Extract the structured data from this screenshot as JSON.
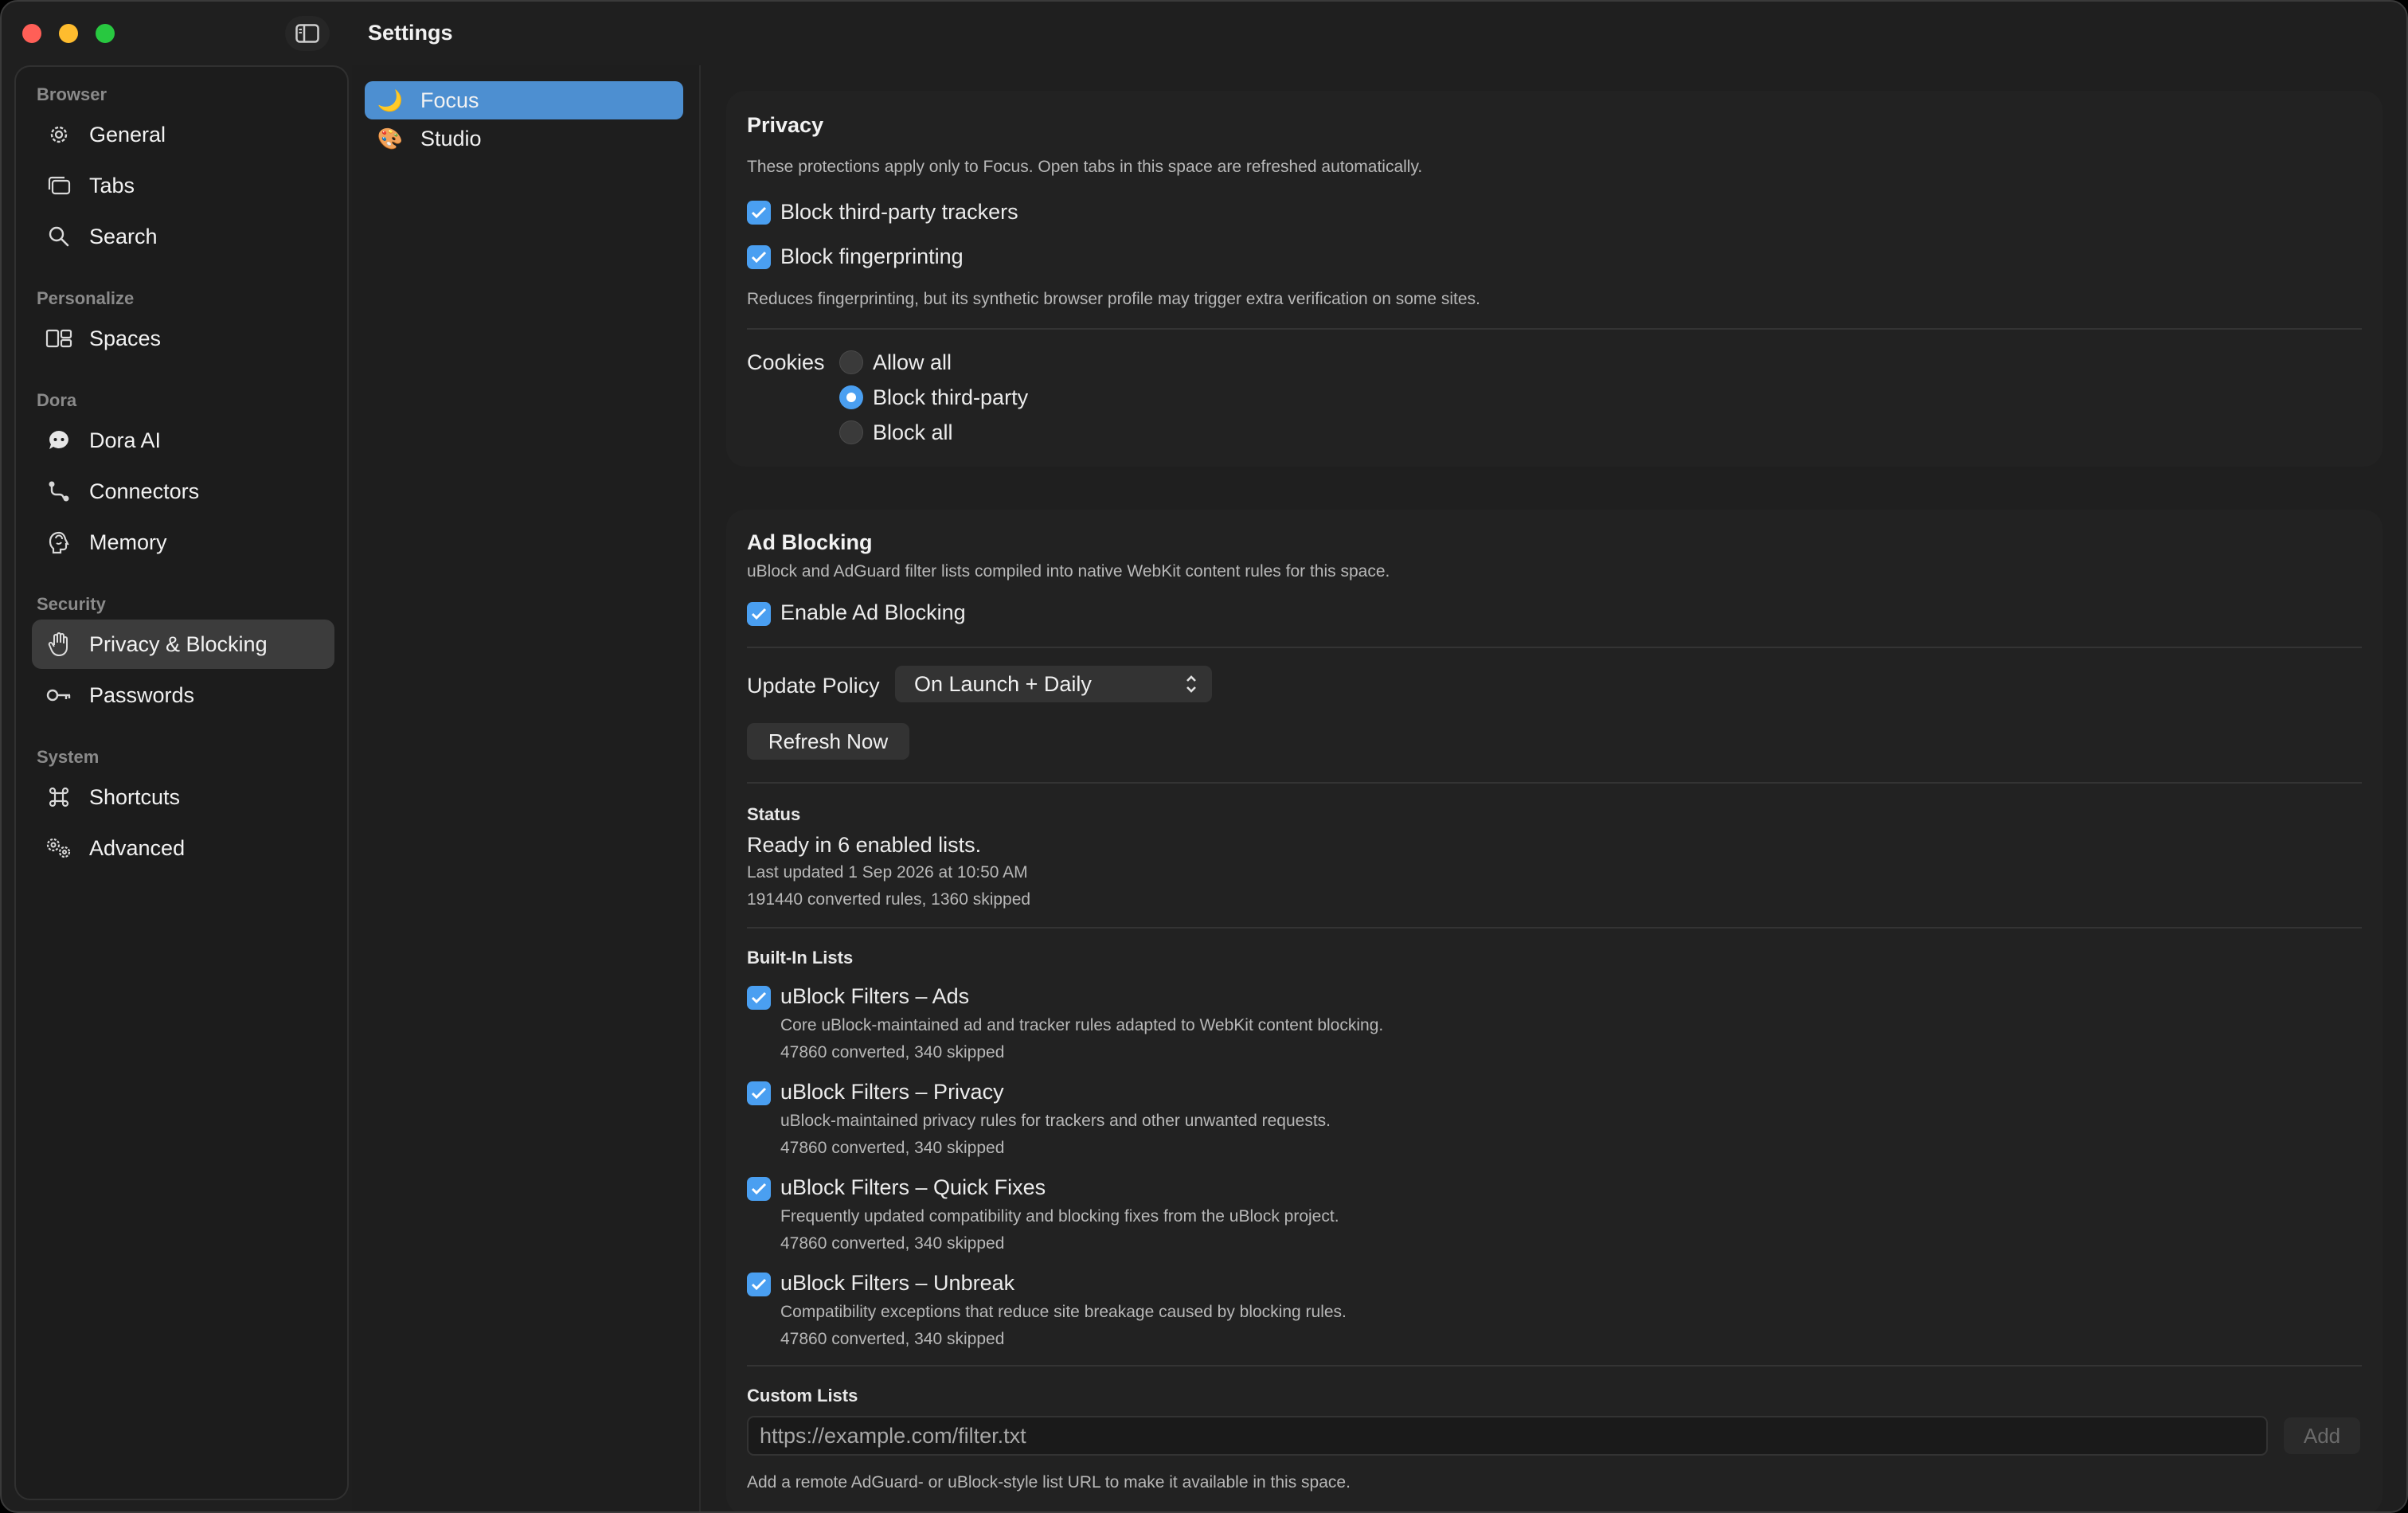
{
  "window": {
    "title": "Settings"
  },
  "sidebar": {
    "sections": [
      {
        "title": "Browser",
        "items": [
          {
            "label": "General",
            "icon": "gear-icon"
          },
          {
            "label": "Tabs",
            "icon": "tabs-icon"
          },
          {
            "label": "Search",
            "icon": "search-icon"
          }
        ]
      },
      {
        "title": "Personalize",
        "items": [
          {
            "label": "Spaces",
            "icon": "spaces-icon"
          }
        ]
      },
      {
        "title": "Dora",
        "items": [
          {
            "label": "Dora AI",
            "icon": "chat-bubble-icon"
          },
          {
            "label": "Connectors",
            "icon": "connector-icon"
          },
          {
            "label": "Memory",
            "icon": "brain-icon"
          }
        ]
      },
      {
        "title": "Security",
        "items": [
          {
            "label": "Privacy & Blocking",
            "icon": "hand-icon",
            "selected": true
          },
          {
            "label": "Passwords",
            "icon": "key-icon"
          }
        ]
      },
      {
        "title": "System",
        "items": [
          {
            "label": "Shortcuts",
            "icon": "command-icon"
          },
          {
            "label": "Advanced",
            "icon": "gears-icon"
          }
        ]
      }
    ]
  },
  "spaces": [
    {
      "label": "Focus",
      "icon": "🌙",
      "selected": true
    },
    {
      "label": "Studio",
      "icon": "🎨"
    }
  ],
  "privacy": {
    "title": "Privacy",
    "description": "These protections apply only to Focus. Open tabs in this space are refreshed automatically.",
    "block_trackers": "Block third-party trackers",
    "block_fingerprinting": "Block fingerprinting",
    "fingerprint_note": "Reduces fingerprinting, but its synthetic browser profile may trigger extra verification on some sites.",
    "cookies_label": "Cookies",
    "cookie_options": [
      "Allow all",
      "Block third-party",
      "Block all"
    ],
    "cookie_selected": "Block third-party"
  },
  "adblock": {
    "title": "Ad Blocking",
    "description": "uBlock and AdGuard filter lists compiled into native WebKit content rules for this space.",
    "enable_label": "Enable Ad Blocking",
    "update_policy_label": "Update Policy",
    "update_policy_value": "On Launch + Daily",
    "refresh_label": "Refresh Now",
    "status": {
      "heading": "Status",
      "line1": "Ready in 6 enabled lists.",
      "line2": "Last updated 1 Sep 2026 at 10:50 AM",
      "line3": "191440 converted rules, 1360 skipped"
    },
    "builtin_heading": "Built-In Lists",
    "lists": [
      {
        "name": "uBlock Filters – Ads",
        "desc": "Core uBlock-maintained ad and tracker rules adapted to WebKit content blocking.",
        "stats": "47860 converted, 340 skipped"
      },
      {
        "name": "uBlock Filters – Privacy",
        "desc": "uBlock-maintained privacy rules for trackers and other unwanted requests.",
        "stats": "47860 converted, 340 skipped"
      },
      {
        "name": "uBlock Filters – Quick Fixes",
        "desc": "Frequently updated compatibility and blocking fixes from the uBlock project.",
        "stats": "47860 converted, 340 skipped"
      },
      {
        "name": "uBlock Filters – Unbreak",
        "desc": "Compatibility exceptions that reduce site breakage caused by blocking rules.",
        "stats": "47860 converted, 340 skipped"
      }
    ],
    "custom_heading": "Custom Lists",
    "custom_placeholder": "https://example.com/filter.txt",
    "add_label": "Add",
    "custom_note": "Add a remote AdGuard- or uBlock-style list URL to make it available in this space."
  },
  "colors": {
    "accent": "#4a9ff1",
    "selected_space": "#4d8fd1"
  }
}
